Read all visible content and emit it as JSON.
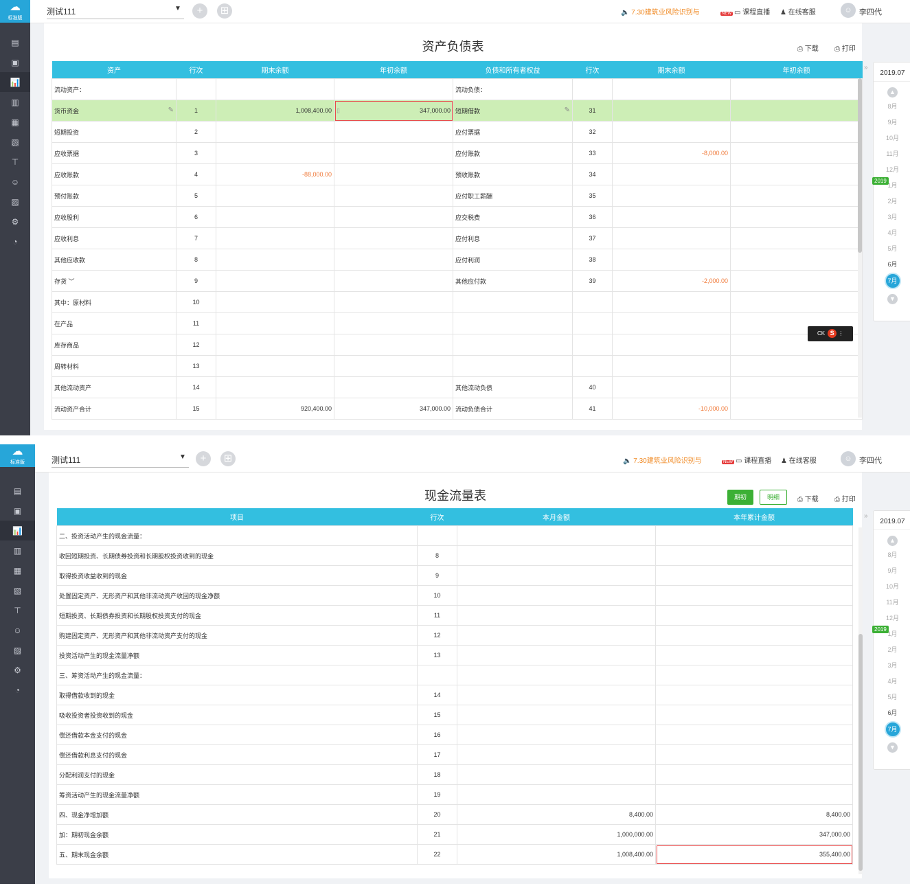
{
  "common": {
    "app_badge": "标准版",
    "account": "测试111",
    "notice": "7.30建筑业风险识别与",
    "new_tag": "NEW",
    "live_link": "课程直播",
    "service_link": "在线客服",
    "username": "李四代",
    "download": "下载",
    "print": "打印",
    "current_period": "2019.07",
    "year_tag": "2019",
    "months": [
      "8月",
      "9月",
      "10月",
      "11月",
      "12月",
      "1月",
      "2月",
      "3月",
      "4月",
      "5月",
      "6月",
      "7月"
    ],
    "selected_month": "7月",
    "ime_label": "CK"
  },
  "balance_sheet": {
    "title": "资产负债表",
    "headers": [
      "资产",
      "行次",
      "期末余额",
      "年初余额",
      "负债和所有者权益",
      "行次",
      "期末余额",
      "年初余额"
    ],
    "rows": [
      {
        "asset": "流动资产：",
        "a_line": "",
        "a_end": "",
        "a_begin": "",
        "liab": "流动负债：",
        "l_line": "",
        "l_end": "",
        "l_begin": ""
      },
      {
        "asset": "货币资金",
        "a_line": "1",
        "a_end": "1,008,400.00",
        "a_begin": "347,000.00",
        "liab": "短期借款",
        "l_line": "31",
        "l_end": "",
        "l_begin": ""
      },
      {
        "asset": "短期投资",
        "a_line": "2",
        "a_end": "",
        "a_begin": "",
        "liab": "应付票据",
        "l_line": "32",
        "l_end": "",
        "l_begin": ""
      },
      {
        "asset": "应收票据",
        "a_line": "3",
        "a_end": "",
        "a_begin": "",
        "liab": "应付账款",
        "l_line": "33",
        "l_end": "-8,000.00",
        "l_begin": ""
      },
      {
        "asset": "应收账款",
        "a_line": "4",
        "a_end": "-88,000.00",
        "a_begin": "",
        "liab": "预收账款",
        "l_line": "34",
        "l_end": "",
        "l_begin": ""
      },
      {
        "asset": "预付账款",
        "a_line": "5",
        "a_end": "",
        "a_begin": "",
        "liab": "应付职工薪酬",
        "l_line": "35",
        "l_end": "",
        "l_begin": ""
      },
      {
        "asset": "应收股利",
        "a_line": "6",
        "a_end": "",
        "a_begin": "",
        "liab": "应交税费",
        "l_line": "36",
        "l_end": "",
        "l_begin": ""
      },
      {
        "asset": "应收利息",
        "a_line": "7",
        "a_end": "",
        "a_begin": "",
        "liab": "应付利息",
        "l_line": "37",
        "l_end": "",
        "l_begin": ""
      },
      {
        "asset": "其他应收款",
        "a_line": "8",
        "a_end": "",
        "a_begin": "",
        "liab": "应付利润",
        "l_line": "38",
        "l_end": "",
        "l_begin": ""
      },
      {
        "asset": "存货 ﹀",
        "a_line": "9",
        "a_end": "",
        "a_begin": "",
        "liab": "其他应付款",
        "l_line": "39",
        "l_end": "-2,000.00",
        "l_begin": ""
      },
      {
        "asset": "其中：原材料",
        "a_line": "10",
        "a_end": "",
        "a_begin": "",
        "liab": "",
        "l_line": "",
        "l_end": "",
        "l_begin": ""
      },
      {
        "asset": "在产品",
        "a_line": "11",
        "a_end": "",
        "a_begin": "",
        "liab": "",
        "l_line": "",
        "l_end": "",
        "l_begin": ""
      },
      {
        "asset": "库存商品",
        "a_line": "12",
        "a_end": "",
        "a_begin": "",
        "liab": "",
        "l_line": "",
        "l_end": "",
        "l_begin": ""
      },
      {
        "asset": "周转材料",
        "a_line": "13",
        "a_end": "",
        "a_begin": "",
        "liab": "",
        "l_line": "",
        "l_end": "",
        "l_begin": ""
      },
      {
        "asset": "其他流动资产",
        "a_line": "14",
        "a_end": "",
        "a_begin": "",
        "liab": "其他流动负债",
        "l_line": "40",
        "l_end": "",
        "l_begin": ""
      },
      {
        "asset": "流动资产合计",
        "a_line": "15",
        "a_end": "920,400.00",
        "a_begin": "347,000.00",
        "liab": "流动负债合计",
        "l_line": "41",
        "l_end": "-10,000.00",
        "l_begin": ""
      }
    ]
  },
  "cash_flow": {
    "title": "现金流量表",
    "btn_period": "期初",
    "btn_detail": "明细",
    "headers": [
      "项目",
      "行次",
      "本月金额",
      "本年累计金额"
    ],
    "rows": [
      {
        "item": "二、投资活动产生的现金流量：",
        "line": "",
        "month": "",
        "year": ""
      },
      {
        "item": "收回短期投资、长期债券投资和长期股权投资收到的现金",
        "line": "8",
        "month": "",
        "year": ""
      },
      {
        "item": "取得投资收益收到的现金",
        "line": "9",
        "month": "",
        "year": ""
      },
      {
        "item": "处置固定资产、无形资产和其他非流动资产收回的现金净额",
        "line": "10",
        "month": "",
        "year": ""
      },
      {
        "item": "短期投资、长期债券投资和长期股权投资支付的现金",
        "line": "11",
        "month": "",
        "year": ""
      },
      {
        "item": "购建固定资产、无形资产和其他非流动资产支付的现金",
        "line": "12",
        "month": "",
        "year": ""
      },
      {
        "item": "投资活动产生的现金流量净额",
        "line": "13",
        "month": "",
        "year": ""
      },
      {
        "item": "三、筹资活动产生的现金流量：",
        "line": "",
        "month": "",
        "year": ""
      },
      {
        "item": "取得借款收到的现金",
        "line": "14",
        "month": "",
        "year": ""
      },
      {
        "item": "吸收投资者投资收到的现金",
        "line": "15",
        "month": "",
        "year": ""
      },
      {
        "item": "偿还借款本金支付的现金",
        "line": "16",
        "month": "",
        "year": ""
      },
      {
        "item": "偿还借款利息支付的现金",
        "line": "17",
        "month": "",
        "year": ""
      },
      {
        "item": "分配利润支付的现金",
        "line": "18",
        "month": "",
        "year": ""
      },
      {
        "item": "筹资活动产生的现金流量净额",
        "line": "19",
        "month": "",
        "year": ""
      },
      {
        "item": "四、现金净增加额",
        "line": "20",
        "month": "8,400.00",
        "year": "8,400.00"
      },
      {
        "item": "加：期初现金余额",
        "line": "21",
        "month": "1,000,000.00",
        "year": "347,000.00"
      },
      {
        "item": "五、期末现金余额",
        "line": "22",
        "month": "1,008,400.00",
        "year": "355,400.00"
      }
    ]
  },
  "colors": {
    "header": "#33bfe0",
    "highlight_row": "#cdeeb6",
    "negative": "#f07a3a",
    "accent": "#27a6d9",
    "green": "#3cb035",
    "sidebar": "#3b3e48"
  },
  "sidebar_icons": [
    "voucher-icon",
    "ledger-icon",
    "report-icon",
    "bank-icon",
    "invoice-icon",
    "tax-icon",
    "asset-icon",
    "salary-icon",
    "archive-icon",
    "settings-icon",
    "speed-icon"
  ]
}
